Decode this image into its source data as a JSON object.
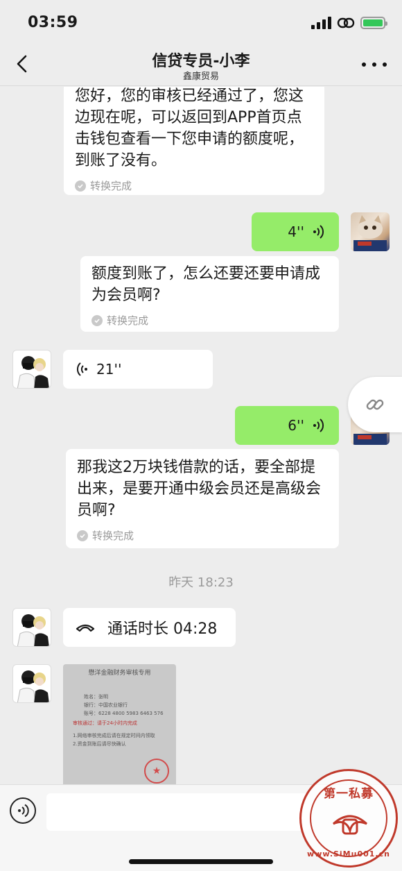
{
  "status": {
    "time": "03:59"
  },
  "header": {
    "title": "信贷专员-小李",
    "subtitle": "鑫康贸易"
  },
  "messages": {
    "m1": {
      "text": "您好，您的审核已经通过了，您这边现在呢，可以返回到APP首页点击钱包查看一下您申请的额度呢，到账了没有。",
      "status": "转换完成"
    },
    "m2": {
      "duration": "4''"
    },
    "m3": {
      "text": "额度到账了，怎么还要还要申请成为会员啊?",
      "status": "转换完成"
    },
    "m4": {
      "duration": "21''"
    },
    "m5": {
      "duration": "6''"
    },
    "m6": {
      "text": "那我这2万块钱借款的话，要全部提出来，是要开通中级会员还是高级会员啊?",
      "status": "转换完成"
    },
    "timestamp": "昨天 18:23",
    "m7": {
      "call": "通话时长 04:28"
    }
  },
  "document": {
    "title": "懋洋金融财务审核专用",
    "name_line": "姓名：张明",
    "bank_line": "银行：中国农业银行",
    "account_line": "账号：6228 4800 5983 6463 576",
    "red_line": "审核通过：请于24小时内完成",
    "note_line1": "1.网络审核完成后请在规定时间内领取",
    "note_line2": "2.资金到账后请尽快确认"
  },
  "watermark": {
    "top": "第一私募",
    "bottom": "www.SiMu001.cn"
  },
  "icons": {
    "back": "chevron-left-icon",
    "more": "more-icon",
    "voice": "voice-wave-icon",
    "phone": "phone-icon",
    "link": "link-icon",
    "check": "check-circle-icon"
  },
  "colors": {
    "sent_bubble": "#95ec69",
    "received_bubble": "#ffffff",
    "background": "#ededed"
  }
}
